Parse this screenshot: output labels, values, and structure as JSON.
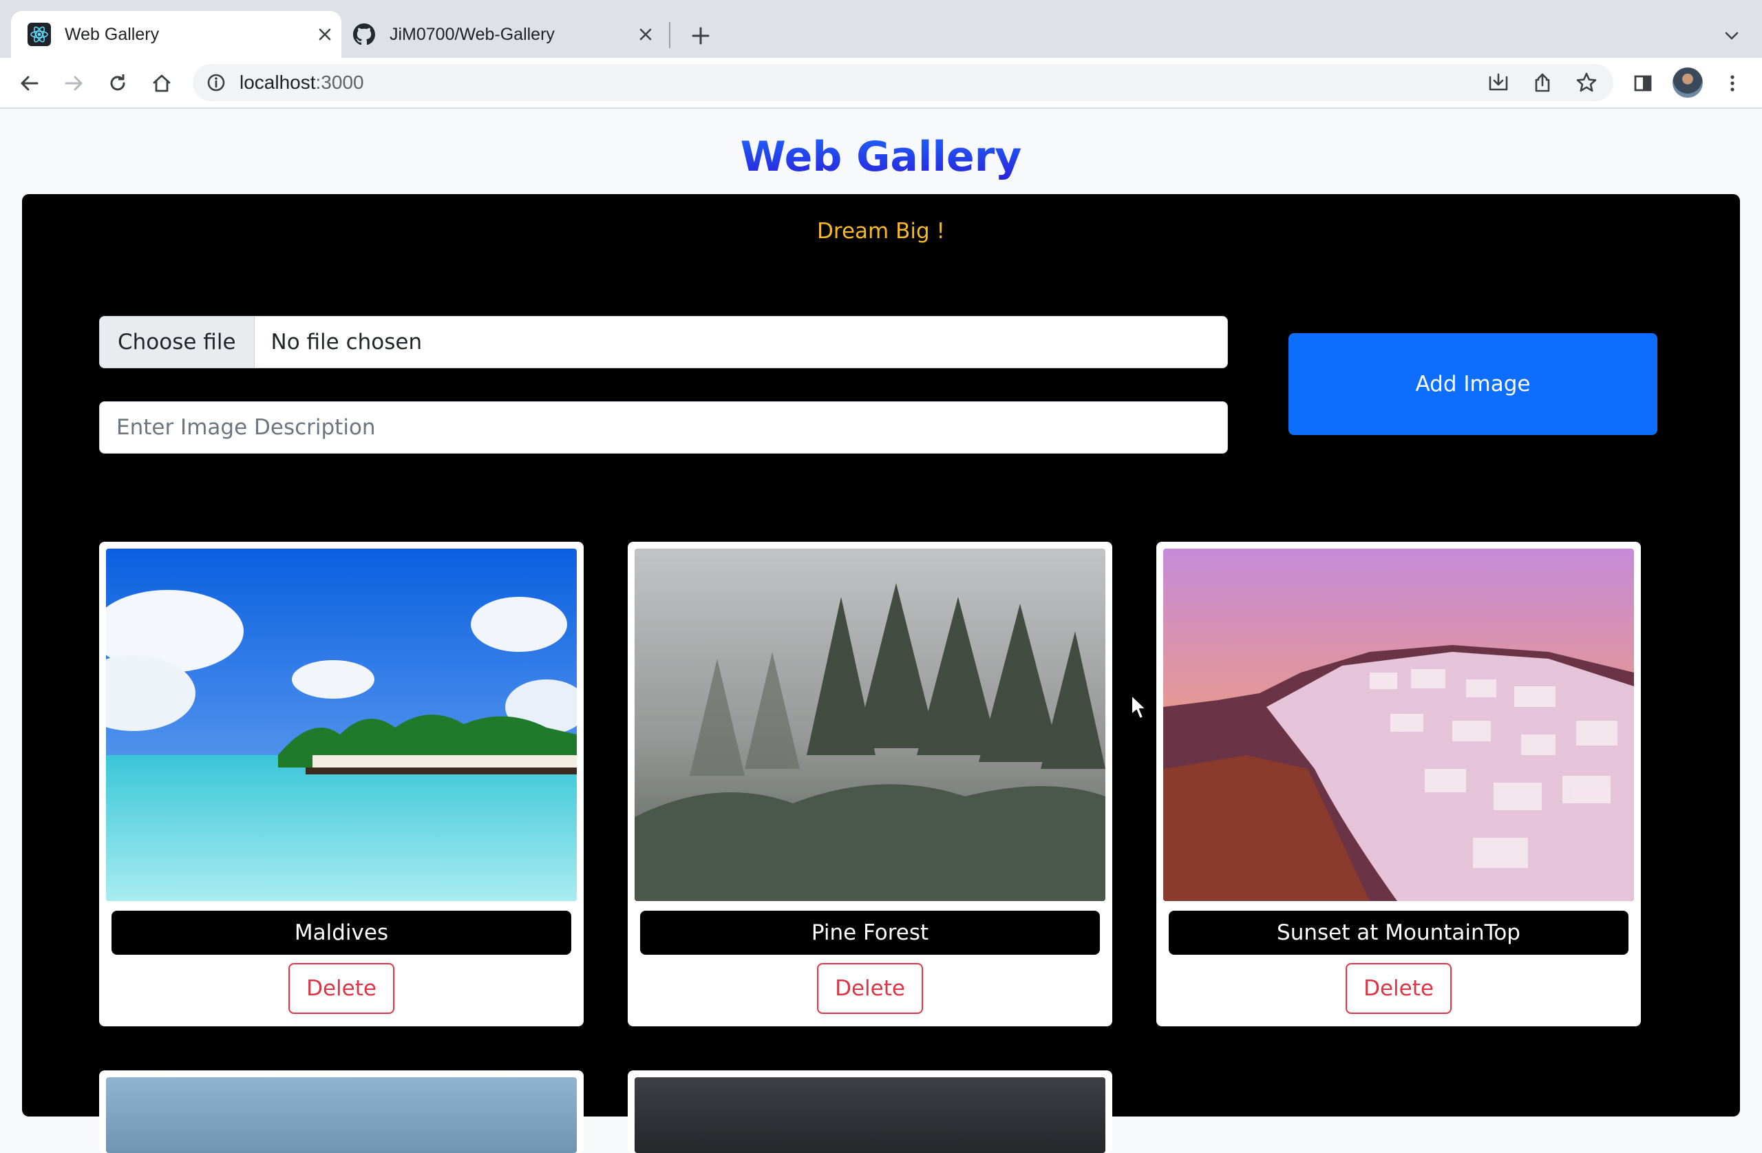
{
  "browser": {
    "tabs": [
      {
        "title": "Web Gallery",
        "icon": "react-icon",
        "active": true
      },
      {
        "title": "JiM0700/Web-Gallery",
        "icon": "github-icon",
        "active": false
      }
    ],
    "url_host": "localhost",
    "url_port": ":3000"
  },
  "page": {
    "title": "Web Gallery",
    "tagline": "Dream Big !",
    "file_button": "Choose file",
    "file_status": "No file chosen",
    "description_placeholder": "Enter Image Description",
    "add_button": "Add Image"
  },
  "gallery": [
    {
      "caption": "Maldives",
      "delete_label": "Delete"
    },
    {
      "caption": "Pine Forest",
      "delete_label": "Delete"
    },
    {
      "caption": "Sunset at MountainTop",
      "delete_label": "Delete"
    }
  ],
  "colors": {
    "accent": "#0d6efd",
    "danger": "#dc3545",
    "tagline": "#f7b924",
    "title_gradient": [
      "#1e6bff",
      "#2a1ad6"
    ]
  }
}
